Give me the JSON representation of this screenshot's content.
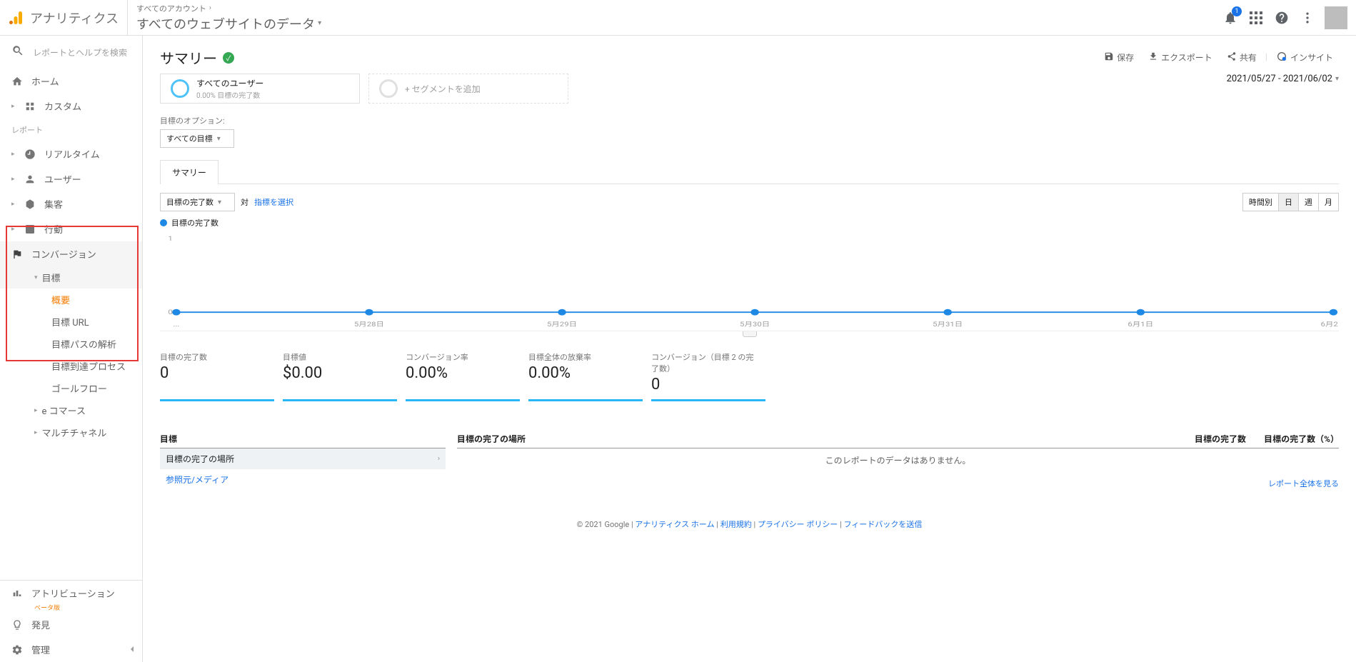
{
  "header": {
    "product": "アナリティクス",
    "breadcrumb1": "すべてのアカウント",
    "view_name": "すべてのウェブサイトのデータ",
    "notif_count": "1"
  },
  "sidebar": {
    "search_placeholder": "レポートとヘルプを検索",
    "home": "ホーム",
    "custom": "カスタム",
    "reports_label": "レポート",
    "realtime": "リアルタイム",
    "audience": "ユーザー",
    "acquisition": "集客",
    "behavior": "行動",
    "conversions": "コンバージョン",
    "goals": "目標",
    "goals_sub": {
      "overview": "概要",
      "goal_urls": "目標 URL",
      "reverse_path": "目標パスの解析",
      "funnel": "目標到達プロセス",
      "goal_flow": "ゴールフロー"
    },
    "ecommerce": "e コマース",
    "multichannel": "マルチチャネル",
    "attribution": "アトリビューション",
    "attribution_beta": "ベータ版",
    "discover": "発見",
    "admin": "管理"
  },
  "page": {
    "title": "サマリー",
    "actions": {
      "save": "保存",
      "export": "エクスポート",
      "share": "共有",
      "insight": "インサイト"
    },
    "segment1_label": "すべてのユーザー",
    "segment1_sub": "0.00% 目標の完了数",
    "add_segment": "+ セグメントを追加",
    "date_range": "2021/05/27 - 2021/06/02",
    "goal_option_label": "目標のオプション:",
    "goal_option_value": "すべての目標",
    "tab_summary": "サマリー",
    "metric_select": "目標の完了数",
    "vs": "対",
    "choose_metric": "指標を選択",
    "time_toggle": {
      "hourly": "時間別",
      "day": "日",
      "week": "週",
      "month": "月"
    },
    "legend_label": "目標の完了数",
    "metrics": [
      {
        "label": "目標の完了数",
        "value": "0"
      },
      {
        "label": "目標値",
        "value": "$0.00"
      },
      {
        "label": "コンバージョン率",
        "value": "0.00%"
      },
      {
        "label": "目標全体の放棄率",
        "value": "0.00%"
      },
      {
        "label": "コンバージョン（目標 2 の完了数）",
        "value": "0"
      }
    ],
    "table_left_header": "目標",
    "table_left_row1": "目標の完了の場所",
    "table_left_row2": "参照元/メディア",
    "table_right_headers": {
      "c1": "目標の完了の場所",
      "c2": "目標の完了数",
      "c3": "目標の完了数（%）"
    },
    "no_data": "このレポートのデータはありません。",
    "full_report": "レポート全体を見る",
    "footer_copyright": "© 2021 Google",
    "footer_links": {
      "home": "アナリティクス ホーム",
      "terms": "利用規約",
      "privacy": "プライバシー ポリシー",
      "feedback": "フィードバックを送信"
    }
  },
  "chart_data": {
    "type": "line",
    "categories": [
      "...",
      "5月28日",
      "5月29日",
      "5月30日",
      "5月31日",
      "6月1日",
      "6月2日"
    ],
    "series": [
      {
        "name": "目標の完了数",
        "values": [
          0,
          0,
          0,
          0,
          0,
          0,
          0
        ]
      }
    ],
    "ylim": [
      0,
      1
    ],
    "yticks": [
      0,
      1
    ],
    "color": "#1e88e5"
  }
}
